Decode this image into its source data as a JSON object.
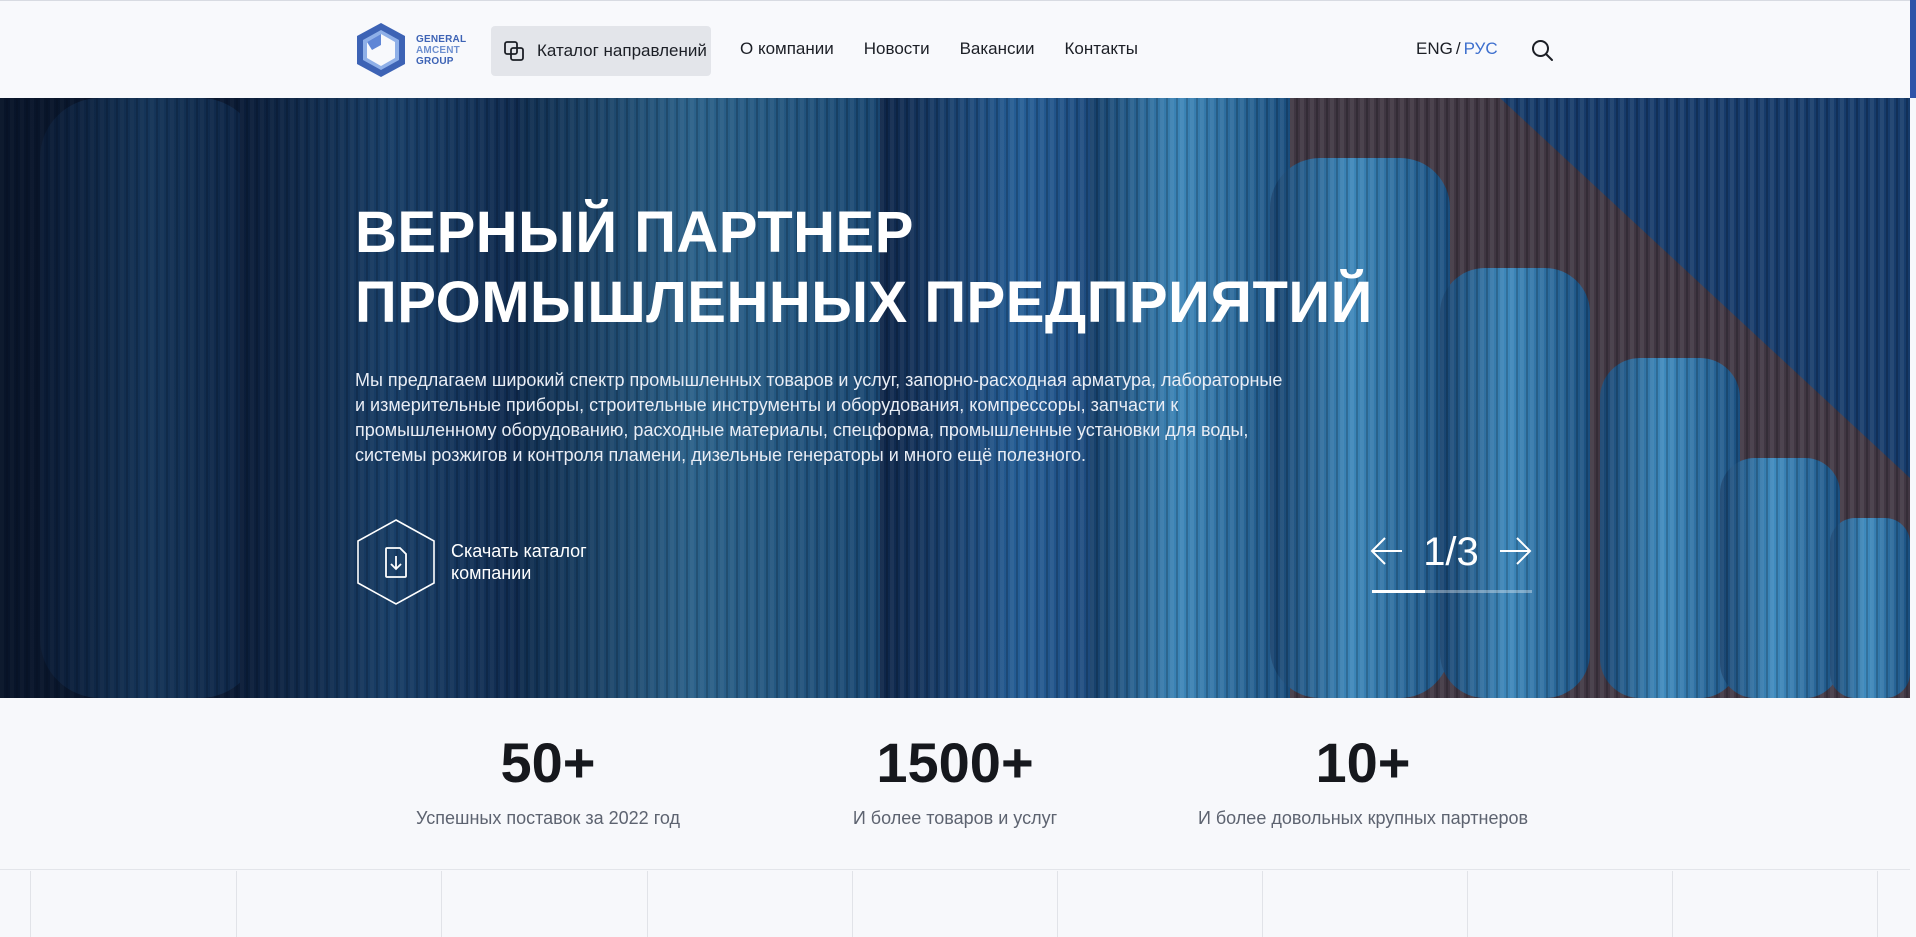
{
  "header": {
    "logo": {
      "line1": "GENERAL",
      "line2": "AMCENT",
      "line3": "GROUP"
    },
    "catalog_button": "Каталог направлений",
    "nav": [
      "О компании",
      "Новости",
      "Вакансии",
      "Контакты"
    ],
    "lang": {
      "eng": "ENG",
      "separator": "/",
      "rus": "РУС",
      "active": "РУС"
    },
    "search_icon": "search-icon",
    "accent_color": "#3d6fce"
  },
  "hero": {
    "title_line1": "ВЕРНЫЙ ПАРТНЕР",
    "title_line2": "ПРОМЫШЛЕННЫХ ПРЕДПРИЯТИЙ",
    "description": "Мы предлагаем широкий спектр промышленных товаров и услуг, запорно-расходная арматура, лабораторные и измерительные приборы, строительные инструменты и оборудования, компрессоры, запчасти к промышленному оборудованию, расходные материалы, спецформа, промышленные установки для воды, системы розжигов и контроля пламени, дизельные генераторы и много ещё полезного.",
    "download_label": "Скачать каталог компании",
    "slider": {
      "current": 1,
      "total": 3,
      "counter": "1/3",
      "progress": 0.33
    }
  },
  "stats": [
    {
      "value": "50+",
      "caption": "Успешных поставок за 2022 год"
    },
    {
      "value": "1500+",
      "caption": "И более товаров и услуг"
    },
    {
      "value": "10+",
      "caption": "И более довольных крупных партнеров"
    }
  ]
}
